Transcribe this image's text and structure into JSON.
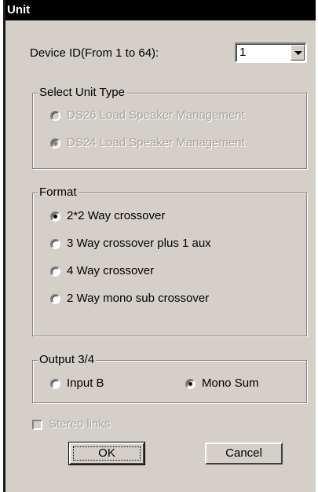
{
  "window": {
    "title": "Unit"
  },
  "device_id": {
    "label": "Device ID(From 1 to 64):",
    "value": "1"
  },
  "unit_type": {
    "title": "Select Unit Type",
    "options": [
      {
        "label": "DS26 Load Speaker Management",
        "selected": false,
        "enabled": false
      },
      {
        "label": "DS24 Load Speaker Management",
        "selected": true,
        "enabled": false
      }
    ]
  },
  "format": {
    "title": "Format",
    "options": [
      {
        "label": "2*2 Way crossover",
        "selected": true
      },
      {
        "label": "3 Way crossover plus 1 aux",
        "selected": false
      },
      {
        "label": "4 Way crossover",
        "selected": false
      },
      {
        "label": "2 Way mono sub crossover",
        "selected": false
      }
    ]
  },
  "output": {
    "title": "Output 3/4",
    "options": [
      {
        "label": "Input B",
        "selected": false
      },
      {
        "label": "Mono Sum",
        "selected": true
      }
    ]
  },
  "stereo_links": {
    "label": "Stereo links",
    "checked": false,
    "enabled": false
  },
  "buttons": {
    "ok": "OK",
    "cancel": "Cancel"
  },
  "colors": {
    "face": "#d4d0c8",
    "title_bg": "#000000",
    "disabled_text": "#a7a49e"
  }
}
